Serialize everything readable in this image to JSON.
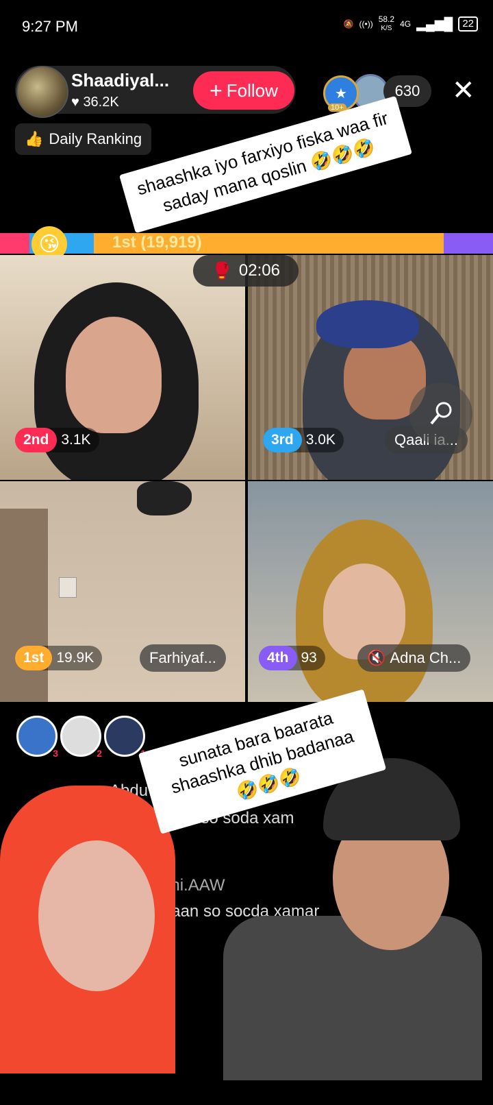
{
  "status_bar": {
    "time": "9:27 PM",
    "net_speed": "58.2",
    "net_unit": "K/S",
    "network": "4G",
    "battery": "22"
  },
  "header": {
    "host_name": "Shaadiyal...",
    "host_likes": "36.2K",
    "follow_label": "Follow",
    "viewer_badge_a": "10+",
    "viewer_badge_b": "9",
    "viewer_count": "630",
    "ranking_label": "Daily Ranking"
  },
  "stickers": {
    "top": "shaashka iyo farxiyo fiska waa fir saday mana qoslin 🤣🤣🤣",
    "bottom": "sunata bara baarata shaashka dhib badanaa 🤣🤣🤣"
  },
  "battle": {
    "bar_text": "1st (19,919)",
    "timer": "02:06"
  },
  "participants": [
    {
      "rank": "2nd",
      "score": "3.1K",
      "name": "",
      "rank_color": "#fe2c55"
    },
    {
      "rank": "3rd",
      "score": "3.0K",
      "name": "Qaali ia...",
      "rank_color": "#2fa7f0"
    },
    {
      "rank": "1st",
      "score": "19.9K",
      "name": "Farhiyaf...",
      "rank_color": "#ffad2f"
    },
    {
      "rank": "4th",
      "score": "93",
      "name": "Adna Ch...",
      "rank_color": "#8a5cf6"
    }
  ],
  "gifters": [
    {
      "rank": "3"
    },
    {
      "rank": "2"
    },
    {
      "rank": "1"
    }
  ],
  "chat": {
    "msg1_user": "Abdu",
    "msg1_text": "an so soda xam",
    "msg2_user": "ahi.AAW",
    "msg2_text": "Vaan so socda xamar"
  }
}
